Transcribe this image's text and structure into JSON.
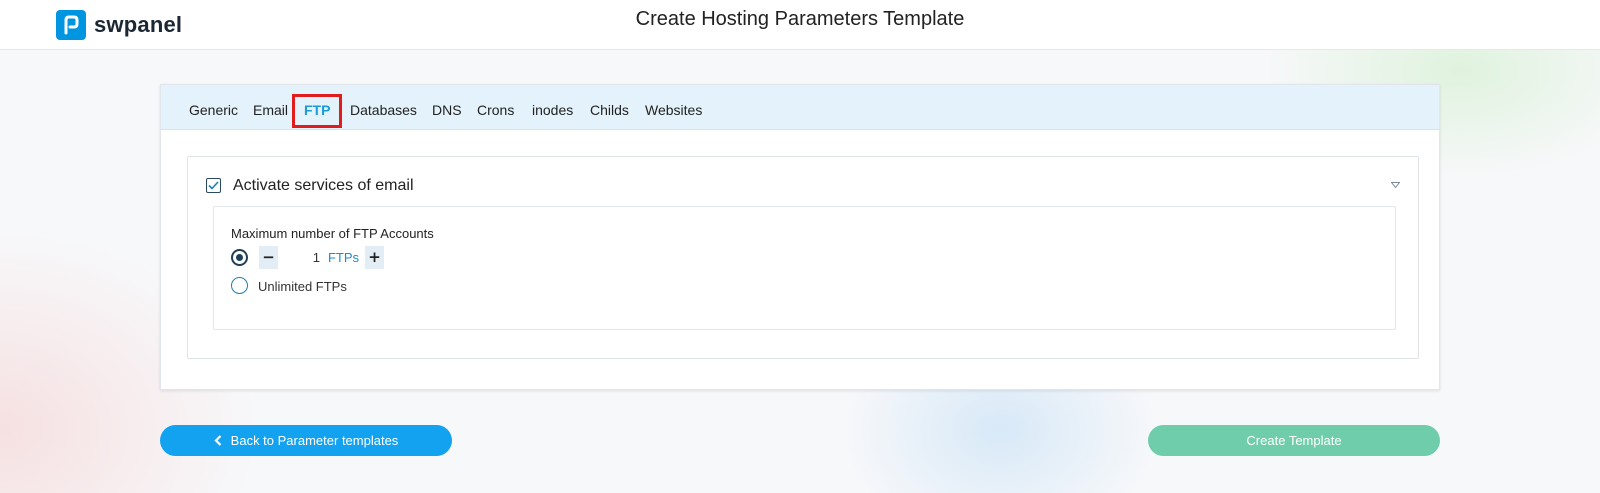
{
  "header": {
    "logo_text": "swpanel",
    "page_title": "Create Hosting Parameters Template"
  },
  "tabs": [
    {
      "label": "Generic",
      "active": false
    },
    {
      "label": "Email",
      "active": false
    },
    {
      "label": "FTP",
      "active": true
    },
    {
      "label": "Databases",
      "active": false
    },
    {
      "label": "DNS",
      "active": false
    },
    {
      "label": "Crons",
      "active": false
    },
    {
      "label": "inodes",
      "active": false
    },
    {
      "label": "Childs",
      "active": false
    },
    {
      "label": "Websites",
      "active": false
    }
  ],
  "panel": {
    "title": "Activate services of email",
    "checked": true,
    "field_label": "Maximum number of FTP Accounts",
    "stepper": {
      "value": "1",
      "unit": "FTPs",
      "minus": "−",
      "plus": "+"
    },
    "unlimited_label": "Unlimited FTPs",
    "selected_option": "limited"
  },
  "buttons": {
    "back_label": "Back to Parameter templates",
    "create_label": "Create Template"
  },
  "colors": {
    "accent": "#12a2ef",
    "create_button": "#6fcdac",
    "tab_active": "#1b9ad8",
    "highlight_box": "#e01c1c"
  }
}
